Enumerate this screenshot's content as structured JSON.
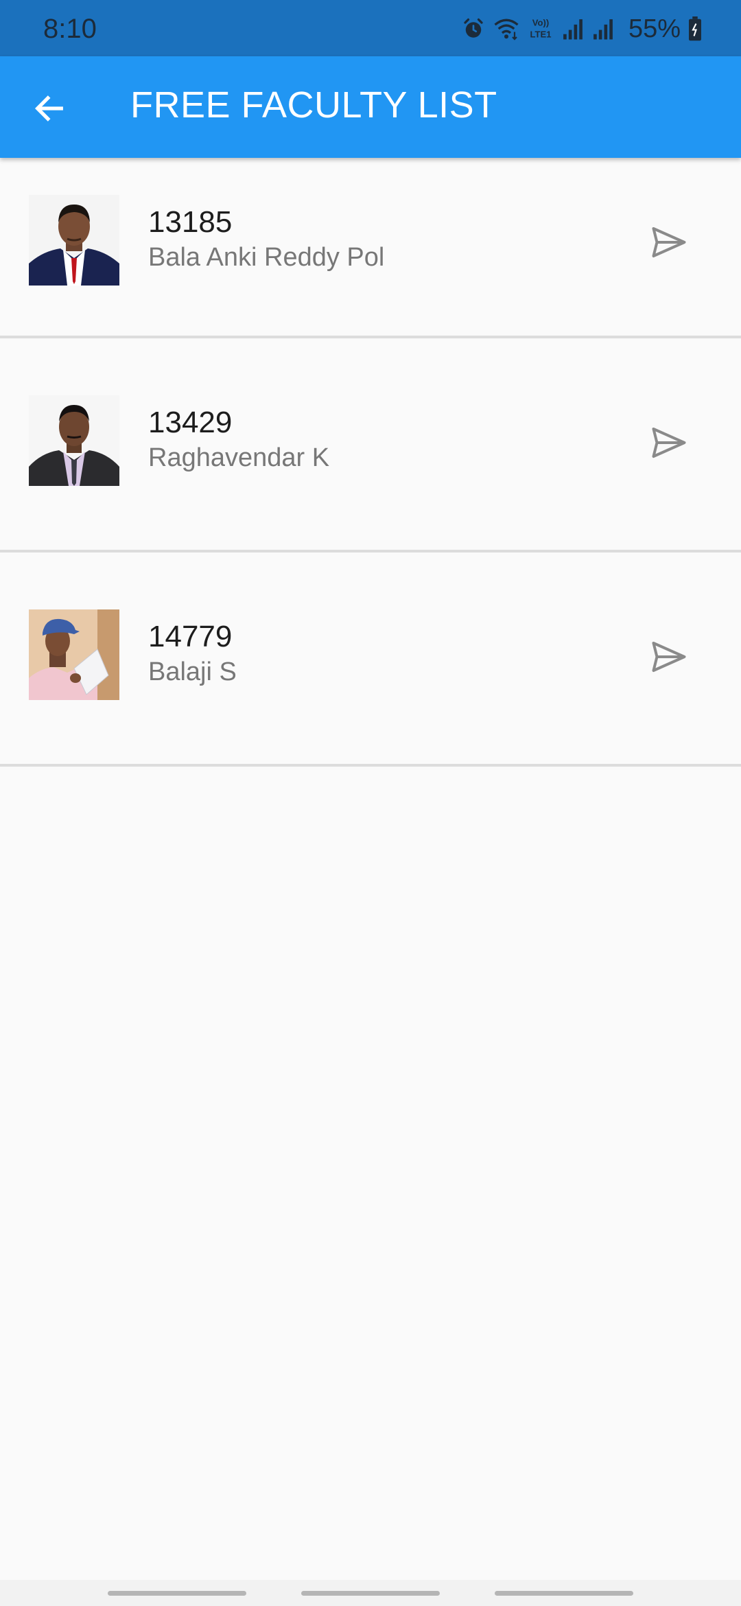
{
  "status_bar": {
    "time": "8:10",
    "battery": "55%",
    "icons": [
      "alarm-icon",
      "wifi-icon",
      "volte-icon",
      "signal-icon",
      "signal-icon",
      "battery-icon"
    ]
  },
  "app_bar": {
    "title": "FREE FACULTY LIST",
    "back_icon": "arrow-left-icon",
    "color": "#2196f3"
  },
  "faculty": [
    {
      "id": "13185",
      "name": "Bala Anki Reddy Pol",
      "avatar": "photo-man-suit-red-tie"
    },
    {
      "id": "13429",
      "name": "Raghavendar K",
      "avatar": "photo-man-dark-suit"
    },
    {
      "id": "14779",
      "name": "Balaji S",
      "avatar": "photo-man-blue-cap"
    }
  ],
  "colors": {
    "status_bar": "#1b71bd",
    "background": "#fafafa",
    "divider": "#dcdcdc",
    "send_icon": "#8a8a8a"
  }
}
